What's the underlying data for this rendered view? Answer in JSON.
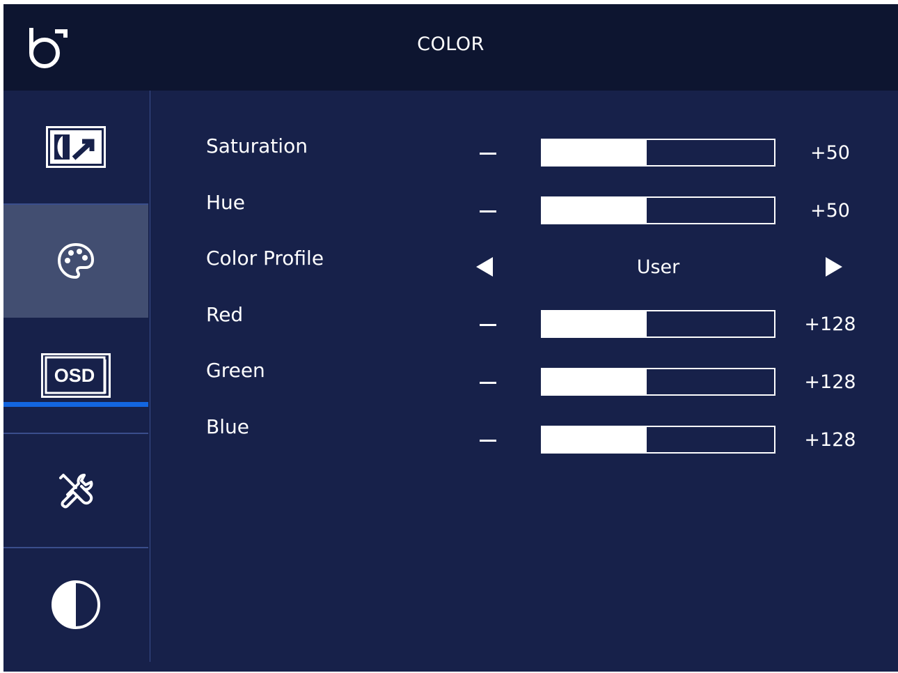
{
  "header": {
    "title": "COLOR",
    "logo_icon": "brand-logo-icon"
  },
  "sidebar": {
    "items": [
      {
        "name": "picture",
        "icon": "picture-icon",
        "active": false
      },
      {
        "name": "color",
        "icon": "palette-icon",
        "active": true
      },
      {
        "name": "osd",
        "icon": "osd-icon",
        "icon_text": "OSD",
        "active": false
      },
      {
        "name": "settings",
        "icon": "tools-icon",
        "active": false
      },
      {
        "name": "contrast",
        "icon": "contrast-icon",
        "active": false
      }
    ],
    "active_indicator_color": "#1366e0"
  },
  "settings": {
    "saturation": {
      "label": "Saturation",
      "value": "+50",
      "level": 0.45
    },
    "hue": {
      "label": "Hue",
      "value": "+50",
      "level": 0.45
    },
    "color_profile": {
      "label": "Color Profile",
      "value": "User"
    },
    "red": {
      "label": "Red",
      "value": "+128",
      "level": 0.45
    },
    "green": {
      "label": "Green",
      "value": "+128",
      "level": 0.45
    },
    "blue": {
      "label": "Blue",
      "value": "+128",
      "level": 0.45
    }
  },
  "colors": {
    "background": "#17214a",
    "header": "#0d1530",
    "active_item": "#424e71",
    "accent": "#1366e0"
  }
}
